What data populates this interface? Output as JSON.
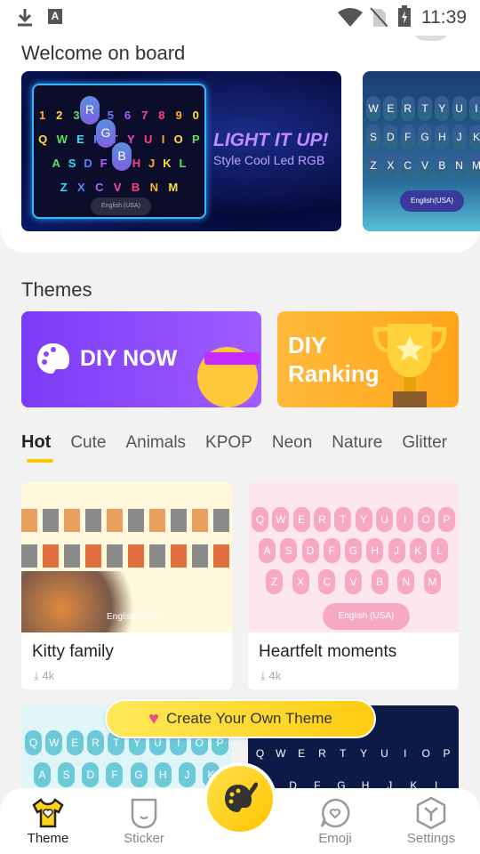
{
  "status_bar": {
    "time": "11:39",
    "icons": [
      "download-icon",
      "keyboard-a-icon",
      "wifi-icon",
      "no-sim-icon",
      "battery-charging-icon"
    ]
  },
  "welcome": {
    "title": "Welcome on board",
    "banner1": {
      "headline": "LIGHT IT UP!",
      "subline": "Style Cool Led RGB",
      "rows": [
        "1234567890",
        "QWERTYUIOP",
        "ASDFGHJKL",
        "ZXCVBNM"
      ],
      "lang": "English (USA)",
      "bubbles": [
        "R",
        "G",
        "B"
      ]
    },
    "banner2": {
      "rows": [
        "WERTYUI",
        "SDFGHJK",
        "ZXCVBNM"
      ],
      "lang": "English(USA)"
    }
  },
  "themes": {
    "title": "Themes",
    "diy_now": "DIY NOW",
    "diy_ranking_1": "DIY",
    "diy_ranking_2": "Ranking"
  },
  "tabs": [
    {
      "label": "Hot",
      "active": true
    },
    {
      "label": "Cute"
    },
    {
      "label": "Animals"
    },
    {
      "label": "KPOP"
    },
    {
      "label": "Neon"
    },
    {
      "label": "Nature"
    },
    {
      "label": "Glitter"
    }
  ],
  "theme_cards": [
    {
      "name": "Kitty family",
      "downloads": "4k",
      "lang": "English (USA)"
    },
    {
      "name": "Heartfelt moments",
      "downloads": "4k",
      "lang": "English (USA)",
      "rows": [
        "QWERTYUIOP",
        "ASDFGHJKL",
        "ZXCVBNM"
      ]
    },
    {
      "rows": [
        "QWERTYUIOP",
        "ASDFGHJK"
      ]
    },
    {
      "rows": [
        "QWERTYUIOP",
        "SDFGHJKL"
      ]
    }
  ],
  "create_button": "Create Your Own Theme",
  "nav": [
    {
      "label": "Theme",
      "active": true
    },
    {
      "label": "Sticker"
    },
    {
      "label": "Emoji"
    },
    {
      "label": "Settings"
    }
  ],
  "colors": {
    "accent": "#ffc700",
    "diy_purple": "#8a48f8",
    "diy_orange": "#ffb02e",
    "pink_key": "#f7a8c4",
    "cyan_key": "#6ccad8"
  }
}
